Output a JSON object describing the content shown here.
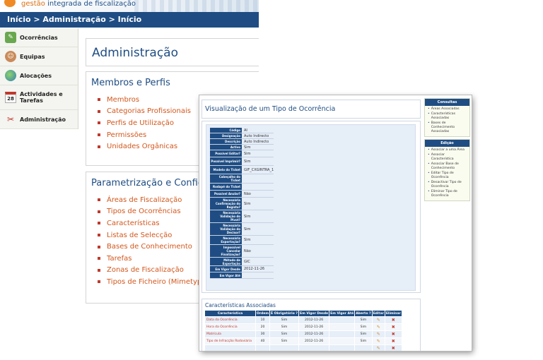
{
  "app": {
    "brand_prefix": "gestão",
    "brand_rest": "integrada de fiscalização",
    "breadcrumb": "Início > Administração > Início"
  },
  "sidebar": {
    "items": [
      {
        "label": "Ocorrências",
        "icon": "occurrences-icon"
      },
      {
        "label": "Equipas",
        "icon": "team-icon"
      },
      {
        "label": "Alocações",
        "icon": "globe-icon"
      },
      {
        "label": "Actividades e Tarefas",
        "icon": "calendar-icon",
        "icon_text": "28"
      },
      {
        "label": "Administração",
        "icon": "tools-icon"
      }
    ]
  },
  "main": {
    "page_title": "Administração",
    "sections": [
      {
        "title": "Membros e Perfis",
        "links": [
          "Membros",
          "Categorias Profissionais",
          "Perfis de Utilização",
          "Permissões",
          "Unidades Orgânicas"
        ]
      },
      {
        "title": "Parametrização e Configu",
        "links": [
          "Áreas de Fiscalização",
          "Tipos de Ocorrências",
          "Características",
          "Listas de Selecção",
          "Bases de Conhecimento",
          "Tarefas",
          "Zonas de Fiscalização",
          "Tipos de Ficheiro (Mimetypes"
        ]
      }
    ]
  },
  "overlay": {
    "title": "Visualização de um Tipo de Ocorrência",
    "fields": [
      {
        "label": "Código",
        "value": "AI"
      },
      {
        "label": "Designação",
        "value": "Auto Indirecto"
      },
      {
        "label": "Descrição",
        "value": "Auto Indirecto"
      },
      {
        "label": "Activo",
        "value": "Sim"
      },
      {
        "label": "Possível Editar?",
        "value": "Sim"
      },
      {
        "label": "Possível Imprimir?",
        "value": "Sim"
      },
      {
        "label": "Modelo do Ticket",
        "value": "GIF_CXGINTRA_1"
      },
      {
        "label": "Cabeçalho do Ticket",
        "value": ""
      },
      {
        "label": "Rodapé do Ticket",
        "value": ""
      },
      {
        "label": "Possível Anular?",
        "value": "Não"
      },
      {
        "label": "Necessária Confirmação do Registo?",
        "value": "Sim"
      },
      {
        "label": "Necessária Validação do Pivot?",
        "value": "Sim"
      },
      {
        "label": "Necessária Validação do Decisor?",
        "value": "Sim"
      },
      {
        "label": "Necessária Exportação?",
        "value": "Sim"
      },
      {
        "label": "Impossível Cancelar Finalização?",
        "value": "Não"
      },
      {
        "label": "Método de Exportação",
        "value": "GIC"
      },
      {
        "label": "Em Vigor Desde",
        "value": "2012-11-26"
      },
      {
        "label": "Em Vigor Até",
        "value": ""
      }
    ],
    "characteristics": {
      "title": "Características Associadas",
      "headers": [
        "Característica",
        "Ordem",
        "É Obrigatório ?",
        "Em Vigor Desde",
        "Em Vigor Até",
        "Aberto ?",
        "Editar",
        "Eliminar"
      ],
      "rows": [
        {
          "name": "Data da Ocorrência",
          "order": "10",
          "required": "Sim",
          "from": "2012-11-26",
          "to": "",
          "open": "Sim"
        },
        {
          "name": "Hora da Ocorrência",
          "order": "20",
          "required": "Sim",
          "from": "2012-11-26",
          "to": "",
          "open": "Sim"
        },
        {
          "name": "Matrícula",
          "order": "30",
          "required": "Sim",
          "from": "2012-11-26",
          "to": "",
          "open": "Sim"
        },
        {
          "name": "Tipo de Infracção Rodoviária",
          "order": "40",
          "required": "Sim",
          "from": "2012-11-26",
          "to": "",
          "open": "Sim"
        },
        {
          "name": "",
          "order": "",
          "required": "",
          "from": "",
          "to": "",
          "open": ""
        }
      ]
    },
    "side_consultas": {
      "title": "Consultas",
      "items": [
        "Áreas Associadas",
        "Características Associadas",
        "Bases de Conhecimento Associadas"
      ]
    },
    "side_edicao": {
      "title": "Edição",
      "items": [
        "Associar a uma Área",
        "Associar Característica",
        "Associar Base de Conhecimento",
        "Editar Tipo de Ocorrência",
        "Desactivar Tipo de Ocorrência",
        "Eliminar Tipo de Ocorrência"
      ]
    }
  }
}
